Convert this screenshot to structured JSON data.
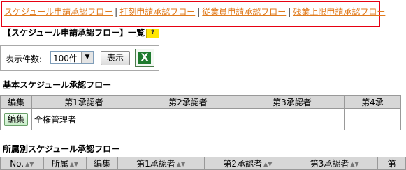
{
  "top_nav": {
    "links": [
      "スケジュール申請承認フロー",
      "打刻申請承認フロー",
      "従業員申請承認フロー",
      "残業上限申請承認フロー"
    ],
    "separator": "|"
  },
  "section_title": "【スケジュール申請承認フロー】一覧",
  "help_icon_text": "?",
  "display_controls": {
    "label": "表示件数:",
    "selected": "100件",
    "show_button": "表示"
  },
  "basic_flow": {
    "title": "基本スケジュール承認フロー",
    "headers": [
      "編集",
      "第1承認者",
      "第2承認者",
      "第3承認者",
      "第4承"
    ],
    "rows": [
      {
        "edit": "編集",
        "cells": [
          "全権管理者",
          "",
          "",
          ""
        ]
      }
    ]
  },
  "dept_flow": {
    "title": "所属別スケジュール承認フロー",
    "headers": [
      "No.",
      "所属",
      "編集",
      "第1承認者",
      "第2承認者",
      "第3承認者",
      "第"
    ]
  },
  "colors": {
    "accent_red": "#e60012",
    "link_orange": "#e07a1c",
    "header_gray": "#d7d7d7",
    "edit_green": "#c6ecc6"
  },
  "icons": [
    "help-icon",
    "excel-icon",
    "dropdown-arrow-icon",
    "sort-icon"
  ]
}
